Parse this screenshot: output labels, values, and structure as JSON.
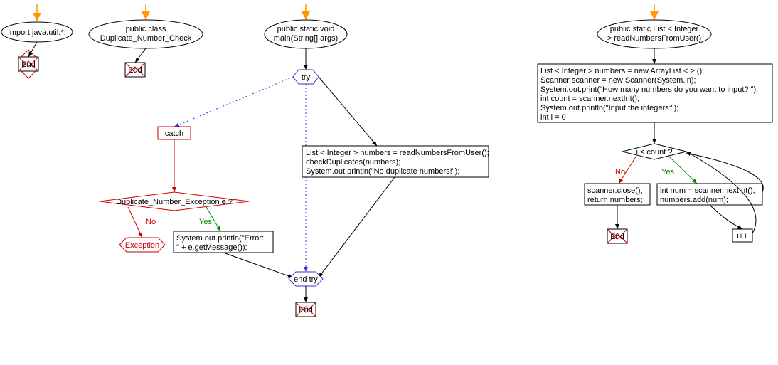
{
  "chart_data": {
    "type": "flowchart",
    "flows": [
      {
        "name": "import",
        "nodes": [
          {
            "id": "import_start",
            "type": "start"
          },
          {
            "id": "import_node",
            "type": "ellipse",
            "text": "import java.util.*;"
          },
          {
            "id": "import_end",
            "type": "end",
            "text": "End"
          }
        ]
      },
      {
        "name": "class",
        "nodes": [
          {
            "id": "class_start",
            "type": "start"
          },
          {
            "id": "class_node",
            "type": "ellipse",
            "text": "public class\nDuplicate_Number_Check"
          },
          {
            "id": "class_end",
            "type": "end",
            "text": "End"
          }
        ]
      },
      {
        "name": "main",
        "nodes": [
          {
            "id": "main_start",
            "type": "start"
          },
          {
            "id": "main_node",
            "type": "ellipse",
            "text": "public static void\nmain(String[] args)"
          },
          {
            "id": "try_node",
            "type": "hexagon",
            "text": "try"
          },
          {
            "id": "catch_node",
            "type": "rect",
            "text": "catch"
          },
          {
            "id": "try_body",
            "type": "rect",
            "text": "List < Integer > numbers = readNumbersFromUser();\ncheckDuplicates(numbers);\nSystem.out.println(\"No duplicate numbers!\");"
          },
          {
            "id": "exception_check",
            "type": "diamond",
            "text": "Duplicate_Number_Exception e ?"
          },
          {
            "id": "exception_no",
            "type": "hexagon_red",
            "text": "Exception"
          },
          {
            "id": "exception_yes",
            "type": "rect",
            "text": "System.out.println(\"Error:\n\" + e.getMessage());"
          },
          {
            "id": "end_try",
            "type": "hexagon",
            "text": "end try"
          },
          {
            "id": "main_end",
            "type": "end",
            "text": "End"
          }
        ]
      },
      {
        "name": "readNumbers",
        "nodes": [
          {
            "id": "read_start",
            "type": "start"
          },
          {
            "id": "read_node",
            "type": "ellipse",
            "text": "public static List < Integer\n> readNumbersFromUser()"
          },
          {
            "id": "read_init",
            "type": "rect",
            "text": "List < Integer > numbers = new ArrayList < > ();\nScanner scanner = new Scanner(System.in);\nSystem.out.print(\"How many numbers do you want to input? \");\nint count = scanner.nextInt();\nSystem.out.println(\"Input the integers:\");\nint i = 0"
          },
          {
            "id": "loop_check",
            "type": "diamond",
            "text": "i < count ?"
          },
          {
            "id": "loop_no",
            "type": "rect",
            "text": "scanner.close();\nreturn numbers;"
          },
          {
            "id": "loop_yes",
            "type": "rect",
            "text": "int num = scanner.nextInt();\nnumbers.add(num);"
          },
          {
            "id": "increment",
            "type": "rect",
            "text": "i++"
          },
          {
            "id": "read_end",
            "type": "end",
            "text": "End"
          }
        ]
      }
    ]
  },
  "labels": {
    "import": "import java.util.*;",
    "class_line1": "public class",
    "class_line2": "Duplicate_Number_Check",
    "main_line1": "public static void",
    "main_line2": "main(String[] args)",
    "try": "try",
    "catch": "catch",
    "try_body_line1": "List < Integer > numbers = readNumbersFromUser();",
    "try_body_line2": "checkDuplicates(numbers);",
    "try_body_line3": "System.out.println(\"No duplicate numbers!\");",
    "exc_check": "Duplicate_Number_Exception e ?",
    "exception": "Exception",
    "exc_yes_line1": "System.out.println(\"Error:",
    "exc_yes_line2": "\" + e.getMessage());",
    "end_try": "end try",
    "end": "End",
    "no": "No",
    "yes": "Yes",
    "read_line1": "public static List < Integer",
    "read_line2": "> readNumbersFromUser()",
    "init_line1": "List < Integer > numbers = new ArrayList < > ();",
    "init_line2": "Scanner scanner = new Scanner(System.in);",
    "init_line3": "System.out.print(\"How many numbers do you want to input? \");",
    "init_line4": "int count = scanner.nextInt();",
    "init_line5": "System.out.println(\"Input the integers:\");",
    "init_line6": "int i = 0",
    "loop_check": "i < count ?",
    "no_body_line1": "scanner.close();",
    "no_body_line2": "return numbers;",
    "yes_body_line1": "int num = scanner.nextInt();",
    "yes_body_line2": "numbers.add(num);",
    "increment": "i++"
  }
}
